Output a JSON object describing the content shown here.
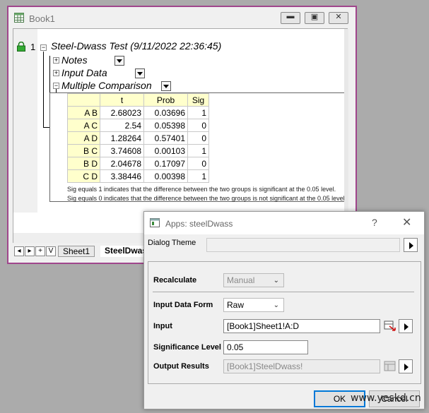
{
  "book": {
    "title": "Book1",
    "row_number": "1",
    "report_title": "Steel-Dwass Test (9/11/2022 22:36:45)",
    "nodes": [
      "Notes",
      "Input Data",
      "Multiple Comparison"
    ],
    "table": {
      "headers": [
        "",
        "t",
        "Prob",
        "Sig"
      ],
      "rows": [
        [
          "A B",
          "2.68023",
          "0.03696",
          "1"
        ],
        [
          "A C",
          "2.54",
          "0.05398",
          "0"
        ],
        [
          "A D",
          "1.28264",
          "0.57401",
          "0"
        ],
        [
          "B C",
          "3.74608",
          "0.00103",
          "1"
        ],
        [
          "B D",
          "2.04678",
          "0.17097",
          "0"
        ],
        [
          "C D",
          "3.38446",
          "0.00398",
          "1"
        ]
      ]
    },
    "notes": [
      "Sig equals 1 indicates that the difference between the two groups is significant at the 0.05 level.",
      "Sig equals 0 indicates that the difference between the two groups is not significant at the 0.05 level."
    ],
    "tabs": {
      "nav": [
        "◂",
        "▸",
        "+",
        "V"
      ],
      "sheets": [
        "Sheet1",
        "SteelDwass"
      ]
    }
  },
  "dialog": {
    "title": "Apps: steelDwass",
    "help": "?",
    "close": "✕",
    "theme_label": "Dialog Theme",
    "recalculate_label": "Recalculate",
    "recalculate_value": "Manual",
    "input_form_label": "Input Data Form",
    "input_form_value": "Raw",
    "input_label": "Input",
    "input_value": "[Book1]Sheet1!A:D",
    "significance_label": "Significance Level",
    "significance_value": "0.05",
    "output_label": "Output Results",
    "output_value": "[Book1]SteelDwass!",
    "ok_label": "OK",
    "cancel_label": "Cancel"
  },
  "watermark": "www.yeskd.cn",
  "colors": {
    "book_border": "#a0468c",
    "table_header": "#ffffcc",
    "focus_blue": "#0078d7"
  }
}
